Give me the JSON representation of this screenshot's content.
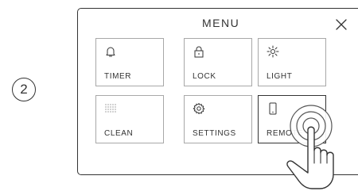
{
  "step": {
    "number": "2"
  },
  "menu": {
    "title": "MENU",
    "close_icon": "close-icon",
    "tiles": [
      {
        "label": "TIMER",
        "icon": "bell-icon"
      },
      {
        "label": "LOCK",
        "icon": "lock-icon"
      },
      {
        "label": "LIGHT",
        "icon": "sun-icon"
      },
      {
        "label": "CLEAN",
        "icon": "dots-grid-icon"
      },
      {
        "label": "SETTINGS",
        "icon": "gear-icon"
      },
      {
        "label": "REMOTE",
        "icon": "phone-icon",
        "selected": true
      }
    ]
  },
  "colors": {
    "line": "#333333",
    "tile_border": "#a8a8a8",
    "background": "#ffffff"
  }
}
